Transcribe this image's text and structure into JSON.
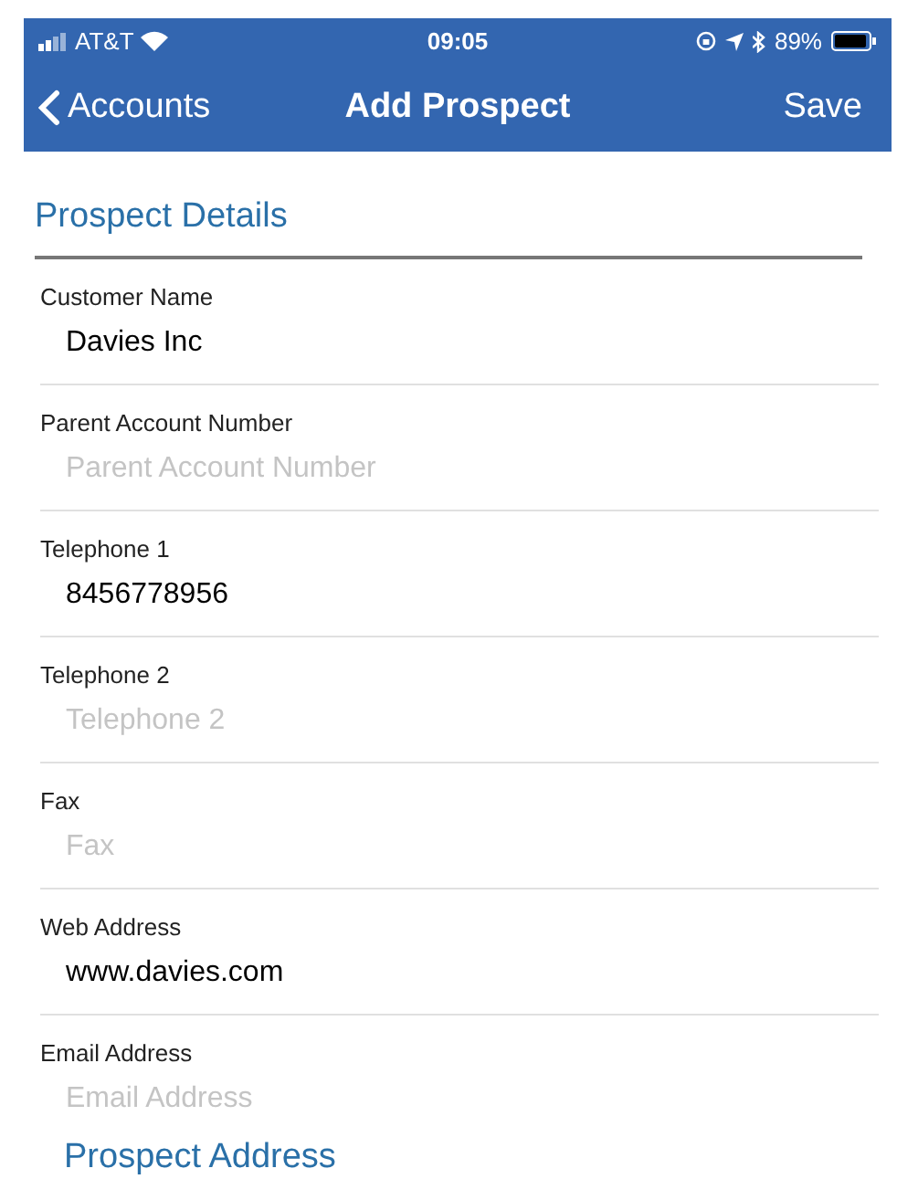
{
  "status_bar": {
    "carrier": "AT&T",
    "time": "09:05",
    "battery": "89%"
  },
  "nav": {
    "back": "Accounts",
    "title": "Add Prospect",
    "action": "Save"
  },
  "sections": [
    {
      "title": "Prospect Details",
      "fields": [
        {
          "label": "Customer Name",
          "value": "Davies Inc"
        },
        {
          "label": "Parent Account Number",
          "placeholder": "Parent Account Number"
        },
        {
          "label": "Telephone 1",
          "value": "8456778956"
        },
        {
          "label": "Telephone 2",
          "placeholder": "Telephone 2"
        },
        {
          "label": "Fax",
          "placeholder": "Fax"
        },
        {
          "label": "Web Address",
          "value": "www.davies.com"
        },
        {
          "label": "Email Address",
          "placeholder": "Email Address"
        }
      ]
    },
    {
      "title": "Prospect Address"
    }
  ]
}
